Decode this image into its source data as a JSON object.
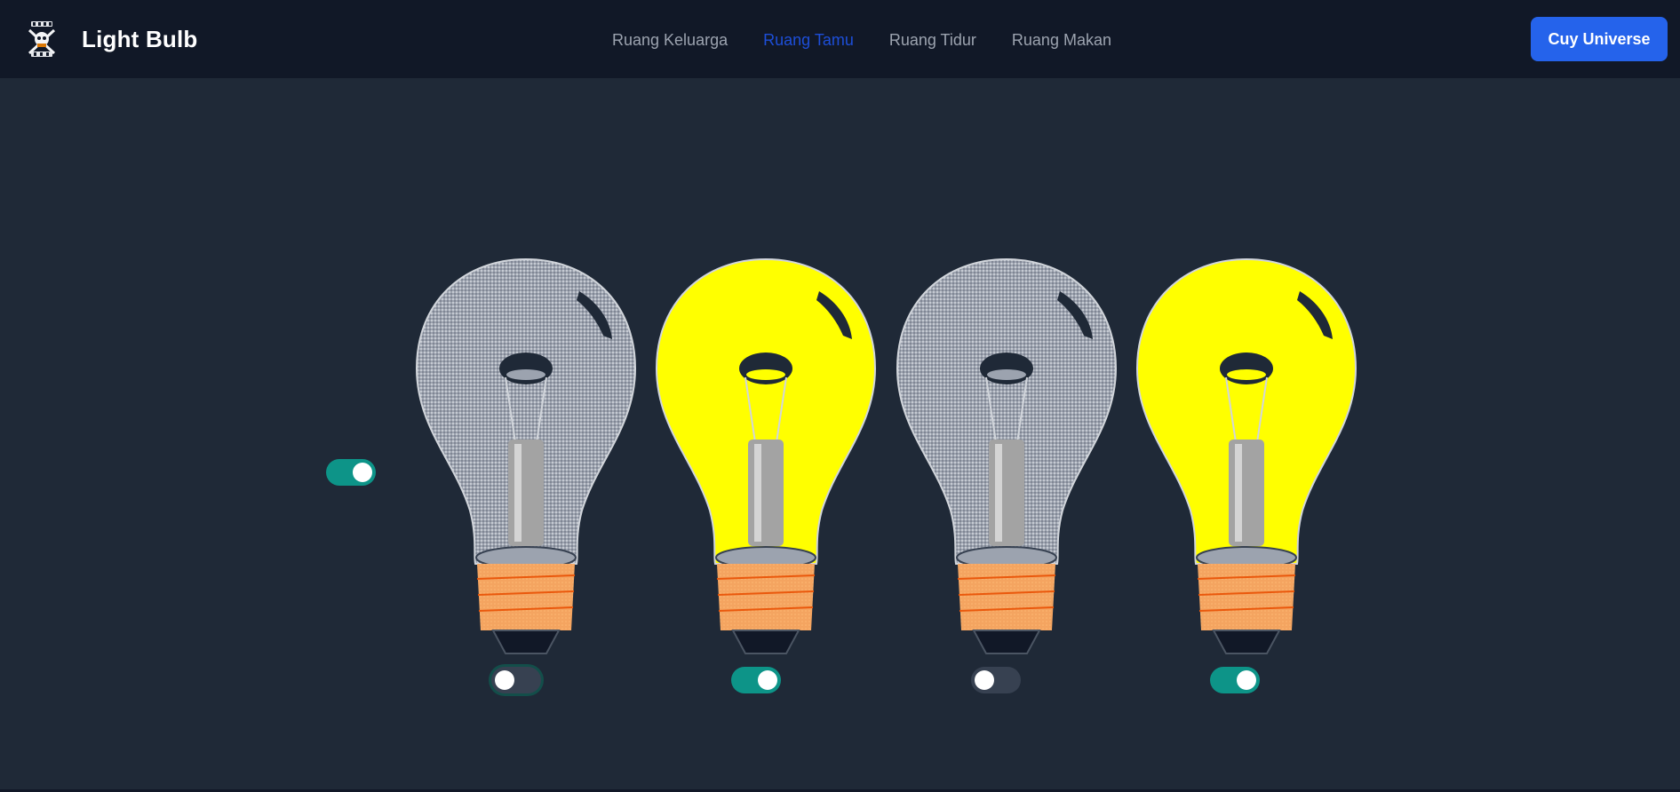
{
  "brand": {
    "title": "Light Bulb",
    "logo_icon": "skull-crossbones-logo-icon"
  },
  "nav": {
    "items": [
      {
        "label": "Ruang Keluarga",
        "active": false
      },
      {
        "label": "Ruang Tamu",
        "active": true
      },
      {
        "label": "Ruang Tidur",
        "active": false
      },
      {
        "label": "Ruang Makan",
        "active": false
      }
    ],
    "active_color": "#1d4ed8",
    "inactive_color": "#9ca3af"
  },
  "cta": {
    "label": "Cuy Universe",
    "color": "#2563eb"
  },
  "master_toggle": {
    "on": true
  },
  "bulbs": [
    {
      "on": false,
      "toggle_on": false,
      "focused": true
    },
    {
      "on": true,
      "toggle_on": true,
      "focused": false
    },
    {
      "on": false,
      "toggle_on": false,
      "focused": false
    },
    {
      "on": true,
      "toggle_on": true,
      "focused": false
    }
  ],
  "colors": {
    "background": "#1f2937",
    "navbar": "#111827",
    "toggle_on": "#0d9488",
    "toggle_off": "#374151",
    "bulb_lit": "#ffff00",
    "bulb_unlit": "#9ca3af",
    "bulb_base": "#f4a460"
  }
}
